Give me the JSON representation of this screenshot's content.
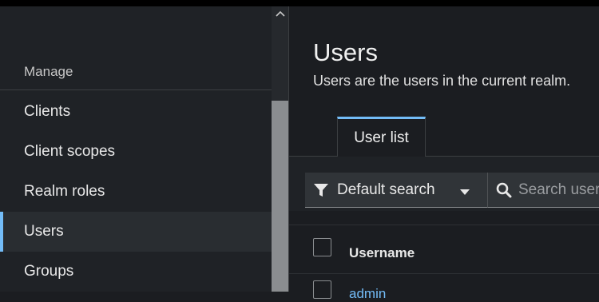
{
  "sidebar": {
    "section_label": "Manage",
    "items": [
      {
        "label": "Clients",
        "active": false
      },
      {
        "label": "Client scopes",
        "active": false
      },
      {
        "label": "Realm roles",
        "active": false
      },
      {
        "label": "Users",
        "active": true
      },
      {
        "label": "Groups",
        "active": false
      }
    ],
    "scroll_up_icon": "chevron-up-icon"
  },
  "main": {
    "title": "Users",
    "description": "Users are the users in the current realm.",
    "tabs": [
      {
        "label": "User list",
        "active": true
      }
    ],
    "toolbar": {
      "filter_label": "Default search",
      "filter_icon": "filter-icon",
      "search_placeholder": "Search user",
      "search_icon": "search-icon"
    },
    "table": {
      "columns": [
        "Username"
      ],
      "first_row_username": "admin"
    }
  },
  "colors": {
    "accent": "#73bcf7",
    "sidebar_bg": "#1f2226",
    "page_bg": "#1b1d21"
  }
}
